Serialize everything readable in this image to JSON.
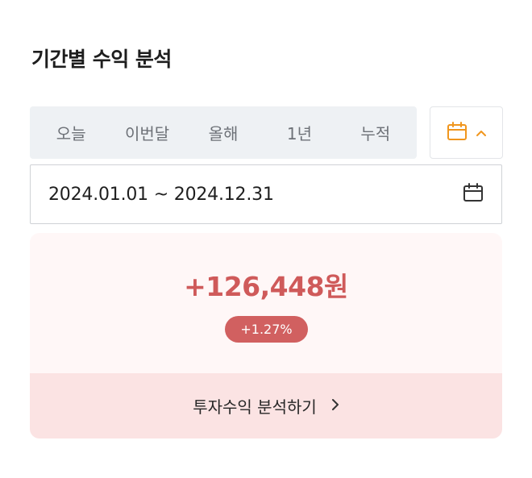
{
  "header": {
    "title": "기간별 수익 분석"
  },
  "period_tabs": [
    {
      "label": "오늘"
    },
    {
      "label": "이번달"
    },
    {
      "label": "올해"
    },
    {
      "label": "1년"
    },
    {
      "label": "누적"
    }
  ],
  "calendar_toggle": {
    "icons": [
      "calendar-icon",
      "chevron-up-icon"
    ],
    "accent_color": "#f0961e"
  },
  "date_range": {
    "text": "2024.01.01 ~ 2024.12.31",
    "icon": "calendar-icon"
  },
  "summary": {
    "profit": "+126,448원",
    "rate": "+1.27%",
    "profit_color": "#cf5a5a",
    "badge_color": "#d16060"
  },
  "analysis_link": {
    "label": "투자수익 분석하기",
    "icon": "chevron-right-icon"
  }
}
